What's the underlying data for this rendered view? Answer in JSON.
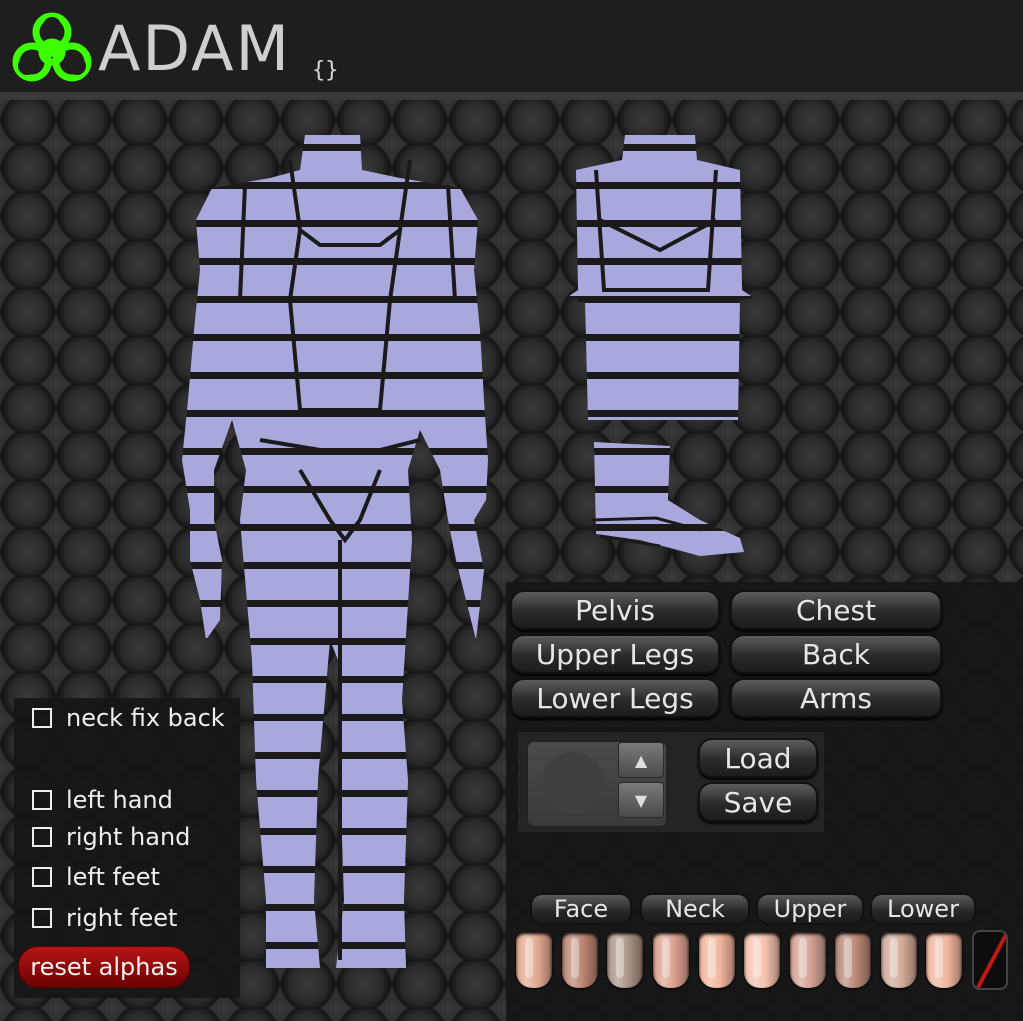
{
  "header": {
    "title": "ADAM",
    "braces": "{}"
  },
  "left_panel": {
    "neck_fix_back": "neck fix back",
    "left_hand": "left hand",
    "right_hand": "right hand",
    "left_feet": "left feet",
    "right_feet": "right feet",
    "reset_alphas": "reset alphas"
  },
  "body_buttons": {
    "pelvis": "Pelvis",
    "chest": "Chest",
    "upper_legs": "Upper Legs",
    "back": "Back",
    "lower_legs": "Lower Legs",
    "arms": "Arms"
  },
  "preset": {
    "load": "Load",
    "save": "Save",
    "up": "▲",
    "down": "▼"
  },
  "skin_tabs": {
    "face": "Face",
    "neck": "Neck",
    "upper": "Upper",
    "lower": "Lower"
  },
  "colors": {
    "uv": "#a9a8dc",
    "reset_button": "#a01010",
    "logo": "#3cff00",
    "swatches": [
      "#e3a890",
      "#b98270",
      "#a99286",
      "#dca08e",
      "#f0b49c",
      "#f2c0ac",
      "#d2a092",
      "#b88674",
      "#cfa996",
      "#eeb49c"
    ]
  }
}
